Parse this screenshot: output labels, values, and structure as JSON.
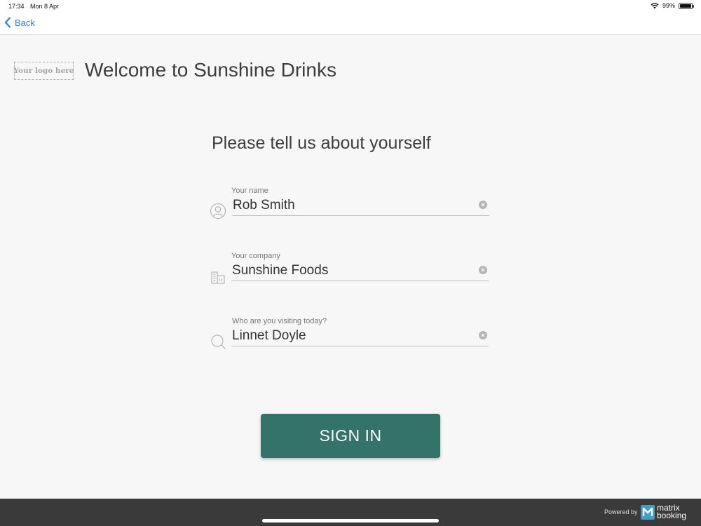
{
  "status_bar": {
    "time": "17:34",
    "date": "Mon 8 Apr",
    "battery": "99%"
  },
  "nav": {
    "back_label": "Back"
  },
  "header": {
    "logo_text": "Your logo here",
    "title": "Welcome to Sunshine Drinks"
  },
  "form": {
    "title": "Please tell us about yourself",
    "fields": [
      {
        "label": "Your name",
        "value": "Rob Smith",
        "icon": "person-icon"
      },
      {
        "label": "Your company",
        "value": "Sunshine Foods",
        "icon": "building-icon"
      },
      {
        "label": "Who are you visiting today?",
        "value": "Linnet Doyle",
        "icon": "search-icon"
      }
    ],
    "submit_label": "SIGN IN"
  },
  "footer": {
    "powered_by": "Powered by",
    "brand_line1": "matrix",
    "brand_line2": "booking"
  },
  "colors": {
    "accent": "#337369",
    "link": "#2f7cf6",
    "footer_bg": "#3a3a3a",
    "background": "#f7f7f7"
  }
}
